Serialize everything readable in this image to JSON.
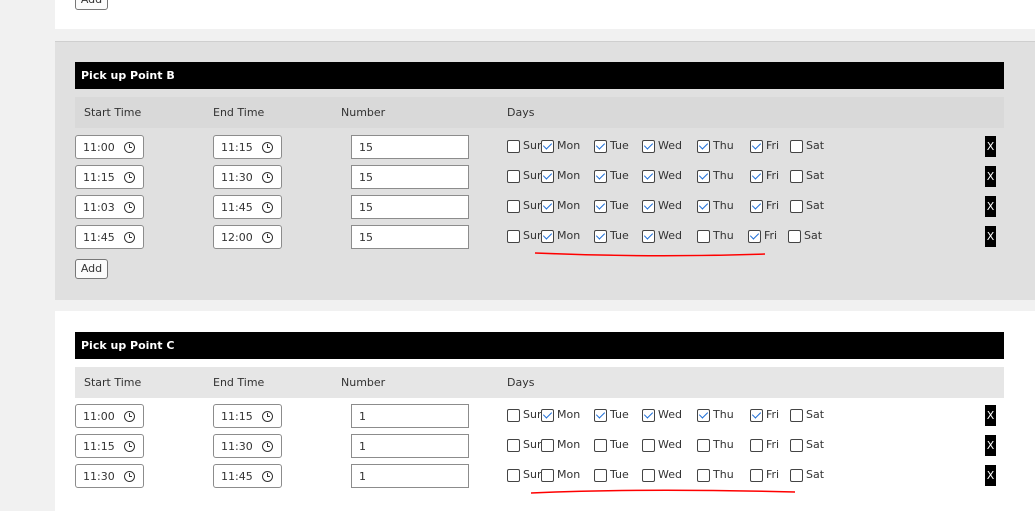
{
  "add_label": "Add",
  "delete_label": "X",
  "headers": {
    "start_time": "Start Time",
    "end_time": "End Time",
    "number": "Number",
    "days": "Days"
  },
  "days": [
    "Sun",
    "Mon",
    "Tue",
    "Wed",
    "Thu",
    "Fri",
    "Sat"
  ],
  "sections": [
    {
      "title": "Pick up Point B",
      "rows": [
        {
          "start": "11:00",
          "end": "11:15",
          "number": "15",
          "checked": [
            false,
            true,
            true,
            true,
            true,
            true,
            false
          ]
        },
        {
          "start": "11:15",
          "end": "11:30",
          "number": "15",
          "checked": [
            false,
            true,
            true,
            true,
            true,
            true,
            false
          ]
        },
        {
          "start": "11:03",
          "end": "11:45",
          "number": "15",
          "checked": [
            false,
            true,
            true,
            true,
            true,
            true,
            false
          ]
        },
        {
          "start": "11:45",
          "end": "12:00",
          "number": "15",
          "checked": [
            false,
            true,
            true,
            true,
            false,
            true,
            false
          ]
        }
      ]
    },
    {
      "title": "Pick up Point C",
      "rows": [
        {
          "start": "11:00",
          "end": "11:15",
          "number": "1",
          "checked": [
            false,
            true,
            true,
            true,
            true,
            true,
            false
          ]
        },
        {
          "start": "11:15",
          "end": "11:30",
          "number": "1",
          "checked": [
            false,
            false,
            false,
            false,
            false,
            false,
            false
          ]
        },
        {
          "start": "11:30",
          "end": "11:45",
          "number": "1",
          "checked": [
            false,
            false,
            false,
            false,
            false,
            false,
            false
          ]
        }
      ]
    }
  ],
  "colors": {
    "annotation": "#ff0000",
    "section_bg": "#e0e0e0",
    "title_bg": "#000000",
    "check": "#1f6fd6"
  }
}
